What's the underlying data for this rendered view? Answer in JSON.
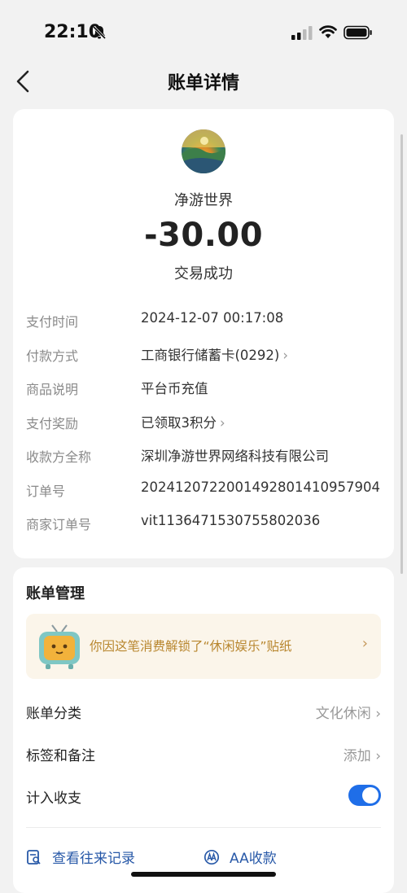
{
  "status_bar": {
    "time": "22:10"
  },
  "nav": {
    "title": "账单详情"
  },
  "transaction": {
    "merchant": "净游世界",
    "amount": "-30.00",
    "status": "交易成功"
  },
  "details": [
    {
      "label": "支付时间",
      "value": "2024-12-07 00:17:08",
      "chevron": false
    },
    {
      "label": "付款方式",
      "value": "工商银行储蓄卡(0292)",
      "chevron": true
    },
    {
      "label": "商品说明",
      "value": "平台币充值",
      "chevron": false
    },
    {
      "label": "支付奖励",
      "value": "已领取3积分",
      "chevron": true
    },
    {
      "label": "收款方全称",
      "value": "深圳净游世界网络科技有限公司",
      "chevron": false
    },
    {
      "label": "订单号",
      "value": "2024120722001492801410957904",
      "chevron": false
    },
    {
      "label": "商家订单号",
      "value": "vit1136471530755802036",
      "chevron": false
    }
  ],
  "management": {
    "title": "账单管理",
    "banner_text": "你因这笔消费解锁了“休闲娱乐”贴纸",
    "category_label": "账单分类",
    "category_value": "文化休闲",
    "tags_label": "标签和备注",
    "tags_value": "添加",
    "count_label": "计入收支",
    "count_enabled": true,
    "view_records": "查看往来记录",
    "aa_collect": "AA收款"
  },
  "colors": {
    "accent": "#1f6ee8",
    "banner_text": "#b8862e",
    "link": "#2859a8"
  }
}
